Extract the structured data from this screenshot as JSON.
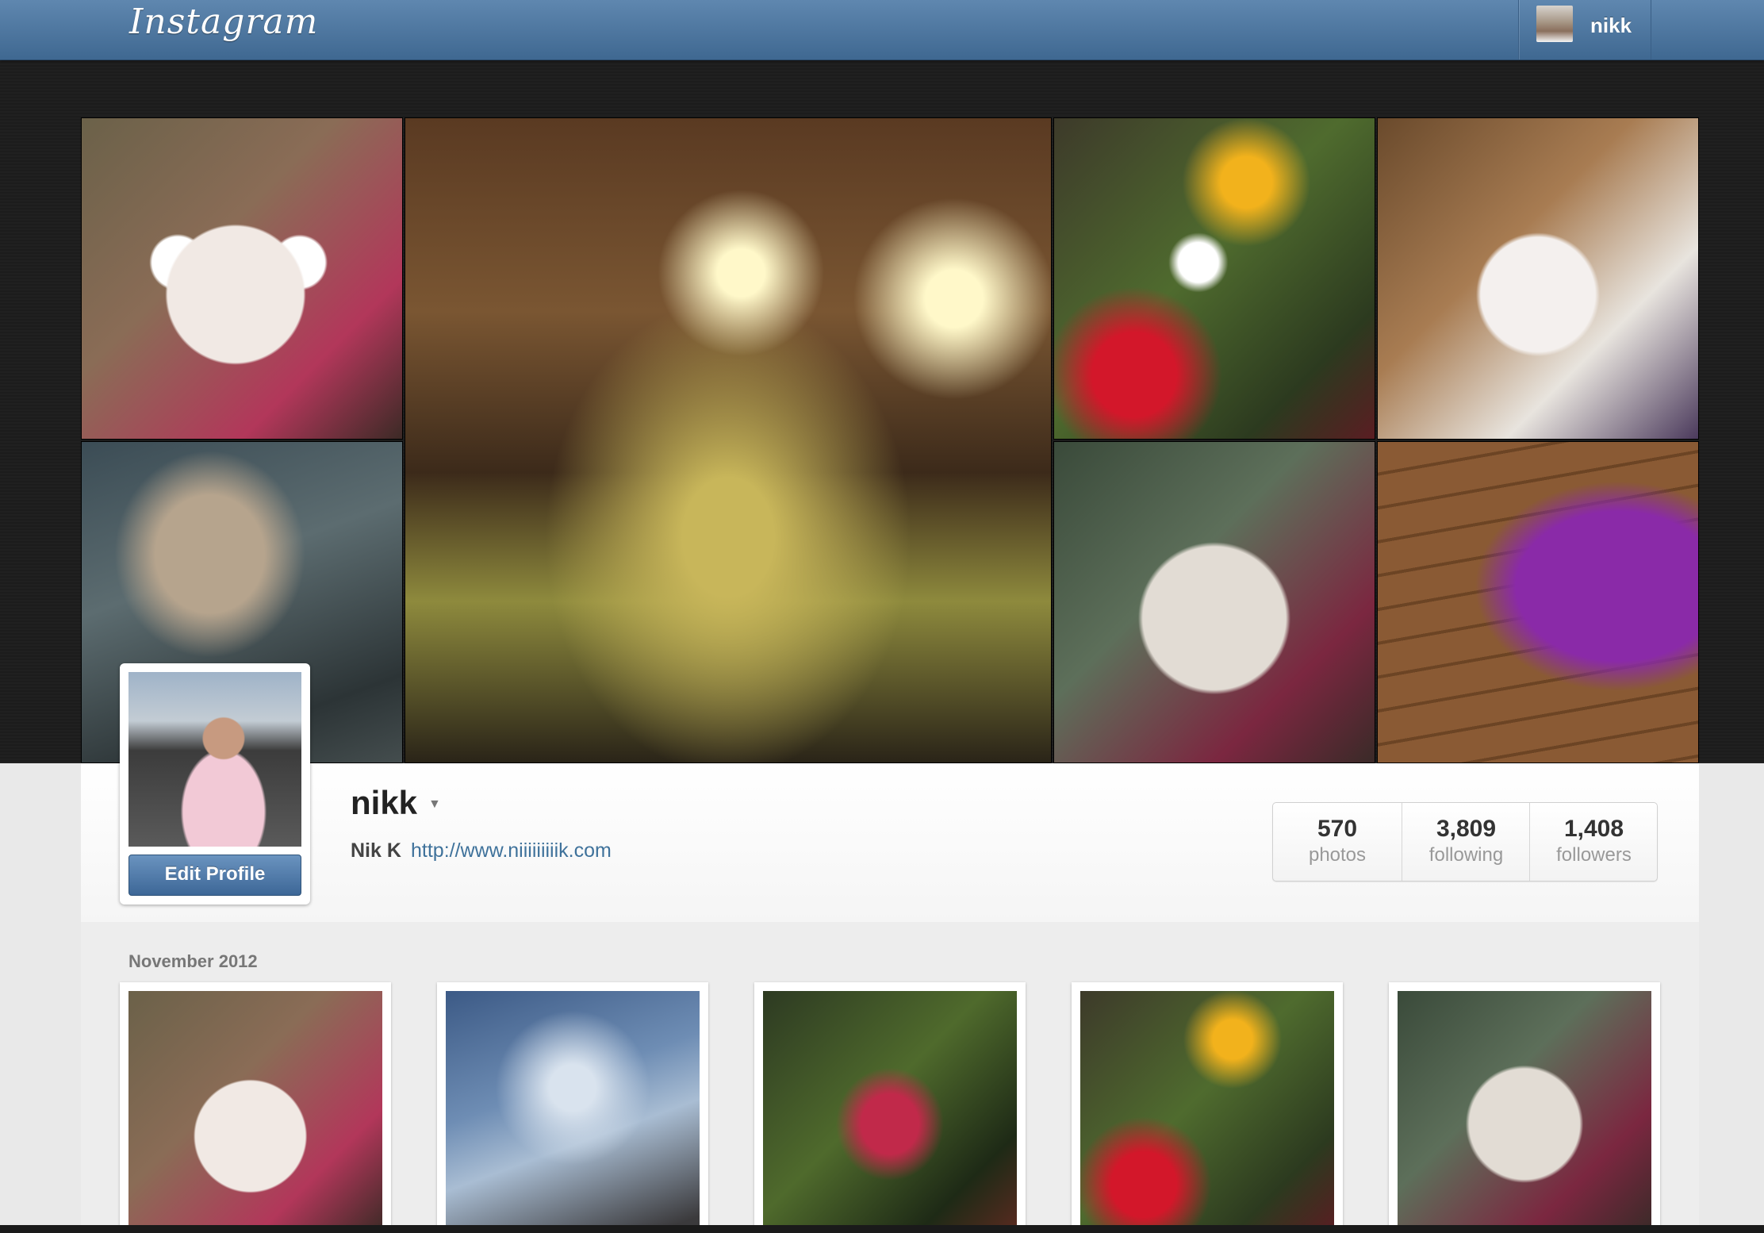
{
  "header": {
    "logo_text": "Instagram",
    "user": {
      "username": "nikk",
      "avatar_icon": "user-avatar-thumbnail"
    },
    "bar_color": "#4f79a3"
  },
  "banner": {
    "tiles": [
      {
        "name": "cover-photo-bunny-dog",
        "subject": "dog with bunny face drawing"
      },
      {
        "name": "cover-photo-fish",
        "subject": "fish in aquarium"
      },
      {
        "name": "cover-photo-tunnel",
        "subject": "road tunnel with motorbike"
      },
      {
        "name": "cover-photo-flowers",
        "subject": "flower table arrangement"
      },
      {
        "name": "cover-photo-dog-window",
        "subject": "white dog near window"
      },
      {
        "name": "cover-photo-dog-closeup",
        "subject": "dog close-up"
      },
      {
        "name": "cover-photo-purple-pillow",
        "subject": "purple pillow on wooden floor"
      }
    ]
  },
  "profile": {
    "username": "nikk",
    "full_name": "Nik K",
    "website": "http://www.niiiiiiiiik.com",
    "edit_button": "Edit Profile",
    "stats": [
      {
        "value": "570",
        "label": "photos"
      },
      {
        "value": "3,809",
        "label": "following"
      },
      {
        "value": "1,408",
        "label": "followers"
      }
    ]
  },
  "feed": {
    "month": "November 2012",
    "photos": [
      {
        "name": "photo-bunny-dog"
      },
      {
        "name": "photo-raindrops-sky"
      },
      {
        "name": "photo-red-plant"
      },
      {
        "name": "photo-flowers"
      },
      {
        "name": "photo-dog"
      }
    ]
  },
  "colors": {
    "accent_blue": "#3f729b",
    "edit_button": "#4f79a8",
    "banner_bg": "#1c1c1c"
  }
}
